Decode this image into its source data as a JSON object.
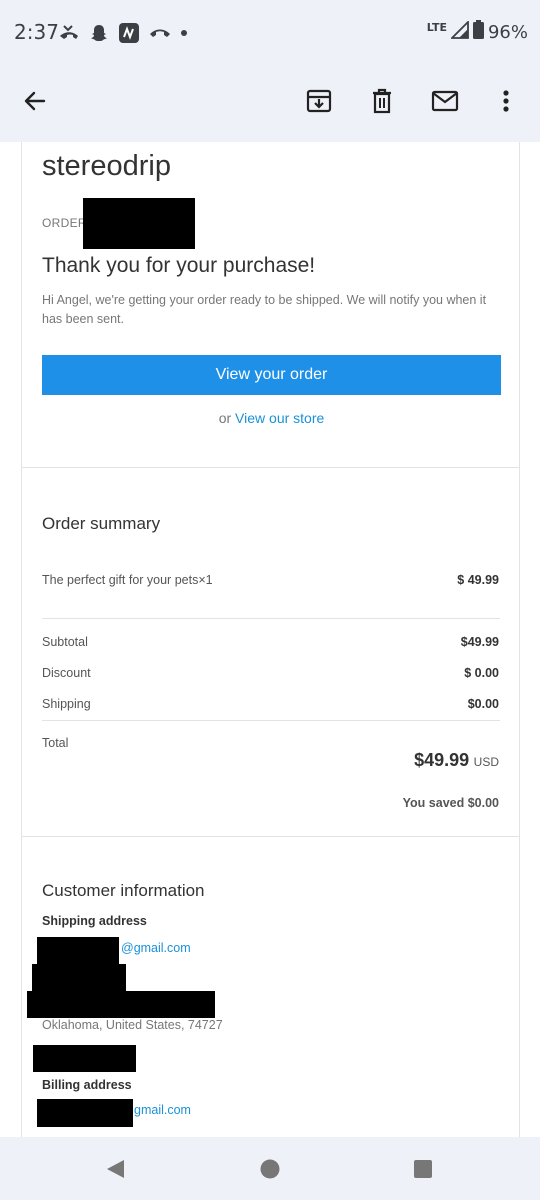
{
  "status_bar": {
    "time": "2:37",
    "network": "LTE",
    "battery": "96%"
  },
  "toolbar": {
    "back_icon": "arrow-left-icon",
    "archive_icon": "archive-icon",
    "delete_icon": "trash-icon",
    "mark_unread_icon": "mail-icon",
    "more_icon": "more-vert-icon"
  },
  "email": {
    "shop_name": "stereodrip",
    "order_label": "ORDER",
    "thank_you": "Thank you for your purchase!",
    "intro": "Hi Angel, we're getting your order ready to be shipped. We will notify you when it has been sent.",
    "view_order_button": "View your order",
    "or_text": "or",
    "view_store_link": "View our store",
    "summary": {
      "title": "Order summary",
      "item_name": "The perfect gift for your pets×1",
      "item_price": "$ 49.99",
      "subtotal_label": "Subtotal",
      "subtotal_value": "$49.99",
      "discount_label": "Discount",
      "discount_value": "$ 0.00",
      "shipping_label": "Shipping",
      "shipping_value": "$0.00",
      "total_label": "Total",
      "total_amount": "$49.99",
      "total_currency": "USD",
      "saved": "You saved $0.00"
    },
    "customer": {
      "title": "Customer information",
      "shipping_title": "Shipping address",
      "shipping_email_visible": "@gmail.com",
      "shipping_location": "Oklahoma, United States, 74727",
      "billing_title": "Billing address",
      "billing_email_visible": "gmail.com"
    }
  },
  "colors": {
    "accent": "#1e90e8",
    "link": "#1a91d8",
    "bar_background": "#eef1f7"
  }
}
